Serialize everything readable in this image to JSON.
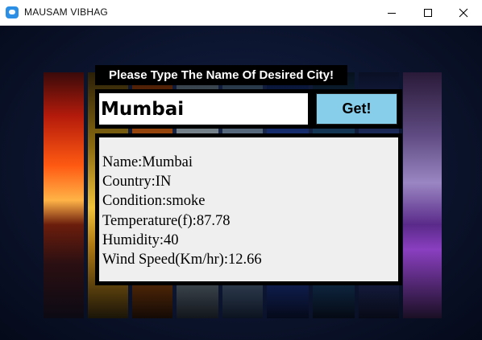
{
  "window": {
    "title": "MAUSAM VIBHAG",
    "icon": "app-icon"
  },
  "controls": {
    "minimize_icon": "minimize-icon",
    "maximize_icon": "maximize-icon",
    "close_icon": "close-icon"
  },
  "form": {
    "heading": "Please Type The Name Of Desired City!",
    "city_value": "Mumbai",
    "button_label": "Get!",
    "button_color": "#87ceeb"
  },
  "result": {
    "lines": [
      "Name:Mumbai",
      "Country:IN",
      "Condition:smoke",
      "Temperature(f):87.78",
      "Humidity:40",
      "Wind Speed(Km/hr):12.66"
    ]
  }
}
